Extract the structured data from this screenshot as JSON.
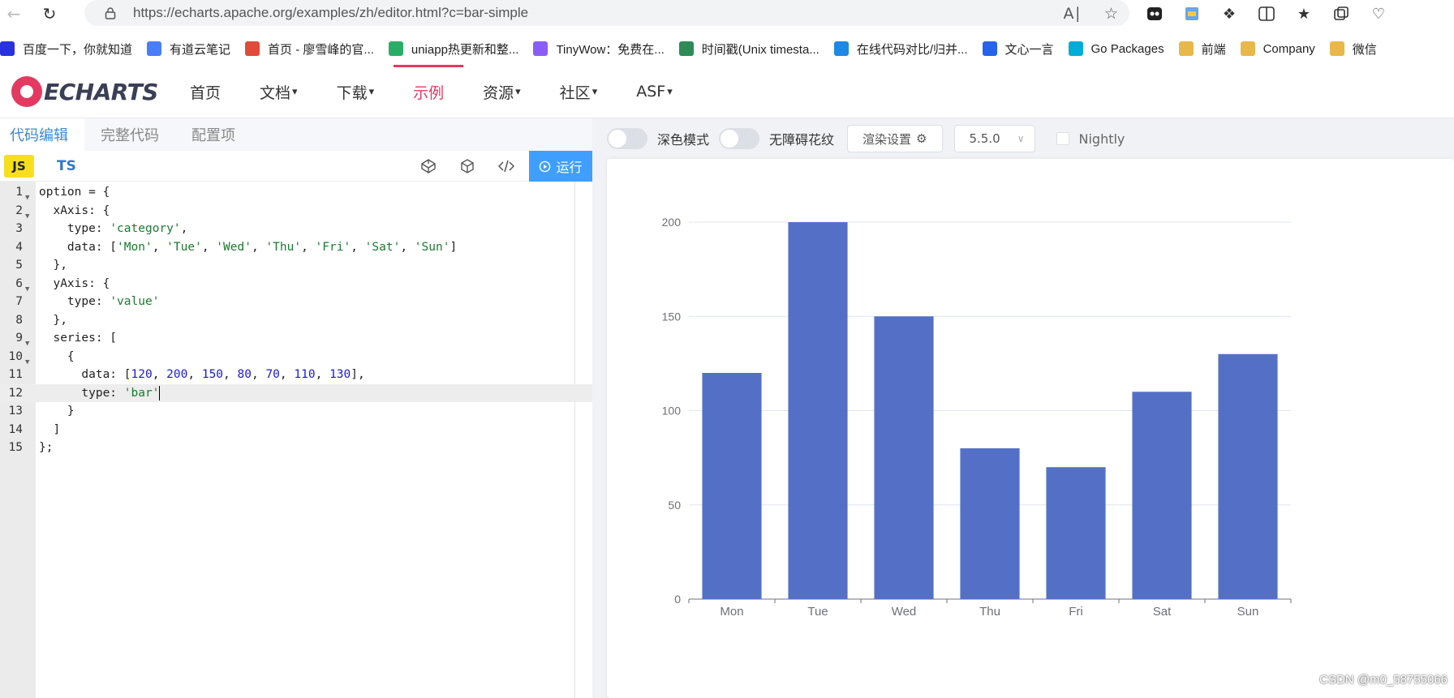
{
  "browser": {
    "url": "https://echarts.apache.org/examples/zh/editor.html?c=bar-simple",
    "bookmarks": [
      {
        "label": "百度一下，你就知道",
        "color": "#2932e1"
      },
      {
        "label": "有道云笔记",
        "color": "#4a7df8"
      },
      {
        "label": "首页 - 廖雪峰的官...",
        "color": "#e04b3a"
      },
      {
        "label": "uniapp热更新和整...",
        "color": "#2aae67"
      },
      {
        "label": "TinyWow：免费在...",
        "color": "#8b5cf6"
      },
      {
        "label": "时间戳(Unix timesta...",
        "color": "#2e8b57"
      },
      {
        "label": "在线代码对比/归并...",
        "color": "#1e88e5"
      },
      {
        "label": "文心一言",
        "color": "#2563eb"
      },
      {
        "label": "Go Packages",
        "color": "#00add8"
      },
      {
        "label": "前端",
        "color": "#e8b84a"
      },
      {
        "label": "Company",
        "color": "#e8b84a"
      },
      {
        "label": "微信",
        "color": "#e8b84a"
      }
    ]
  },
  "site": {
    "logo_text": "ECHARTS",
    "menu": [
      {
        "label": "首页",
        "dropdown": false,
        "active": false
      },
      {
        "label": "文档",
        "dropdown": true,
        "active": false
      },
      {
        "label": "下载",
        "dropdown": true,
        "active": false
      },
      {
        "label": "示例",
        "dropdown": false,
        "active": true
      },
      {
        "label": "资源",
        "dropdown": true,
        "active": false
      },
      {
        "label": "社区",
        "dropdown": true,
        "active": false
      },
      {
        "label": "ASF",
        "dropdown": true,
        "active": false
      }
    ]
  },
  "editor": {
    "tabs": [
      "代码编辑",
      "完整代码",
      "配置项"
    ],
    "lang_js": "JS",
    "lang_ts": "TS",
    "run_label": "运行",
    "current_line": 12,
    "lines": [
      {
        "n": "1",
        "fold": true,
        "code": "option = {"
      },
      {
        "n": "2",
        "fold": true,
        "code": "  xAxis: {"
      },
      {
        "n": "3",
        "fold": false,
        "code": "    type: 'category',"
      },
      {
        "n": "4",
        "fold": false,
        "code": "    data: ['Mon', 'Tue', 'Wed', 'Thu', 'Fri', 'Sat', 'Sun']"
      },
      {
        "n": "5",
        "fold": false,
        "code": "  },"
      },
      {
        "n": "6",
        "fold": true,
        "code": "  yAxis: {"
      },
      {
        "n": "7",
        "fold": false,
        "code": "    type: 'value'"
      },
      {
        "n": "8",
        "fold": false,
        "code": "  },"
      },
      {
        "n": "9",
        "fold": true,
        "code": "  series: ["
      },
      {
        "n": "10",
        "fold": true,
        "code": "    {"
      },
      {
        "n": "11",
        "fold": false,
        "code": "      data: [120, 200, 150, 80, 70, 110, 130],"
      },
      {
        "n": "12",
        "fold": false,
        "code": "      type: 'bar'"
      },
      {
        "n": "13",
        "fold": false,
        "code": "    }"
      },
      {
        "n": "14",
        "fold": false,
        "code": "  ]"
      },
      {
        "n": "15",
        "fold": false,
        "code": "};"
      }
    ]
  },
  "preview": {
    "dark_mode_label": "深色模式",
    "a11y_label": "无障碍花纹",
    "render_settings_label": "渲染设置",
    "version": "5.5.0",
    "nightly_label": "Nightly",
    "watermark": "CSDN @m0_58755066"
  },
  "chart_data": {
    "type": "bar",
    "categories": [
      "Mon",
      "Tue",
      "Wed",
      "Thu",
      "Fri",
      "Sat",
      "Sun"
    ],
    "values": [
      120,
      200,
      150,
      80,
      70,
      110,
      130
    ],
    "ylim": [
      0,
      200
    ],
    "yticks": [
      0,
      50,
      100,
      150,
      200
    ],
    "color": "#5470c6",
    "grid": true
  }
}
